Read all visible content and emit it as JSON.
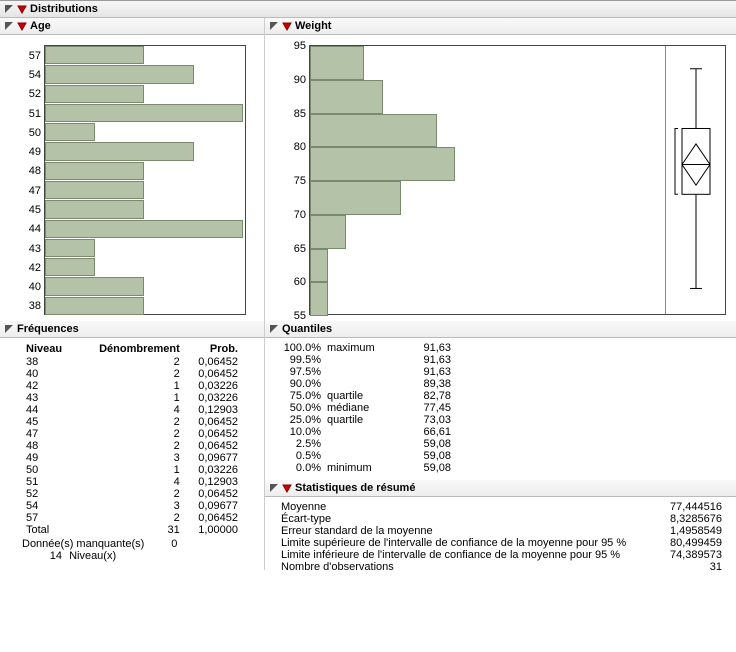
{
  "main": {
    "title": "Distributions"
  },
  "age": {
    "title": "Age",
    "freq_title": "Fréquences",
    "headers": {
      "level": "Niveau",
      "count": "Dénombrement",
      "prob": "Prob."
    },
    "rows": [
      {
        "level": "38",
        "count": 2,
        "prob": "0,06452"
      },
      {
        "level": "40",
        "count": 2,
        "prob": "0,06452"
      },
      {
        "level": "42",
        "count": 1,
        "prob": "0,03226"
      },
      {
        "level": "43",
        "count": 1,
        "prob": "0,03226"
      },
      {
        "level": "44",
        "count": 4,
        "prob": "0,12903"
      },
      {
        "level": "45",
        "count": 2,
        "prob": "0,06452"
      },
      {
        "level": "47",
        "count": 2,
        "prob": "0,06452"
      },
      {
        "level": "48",
        "count": 2,
        "prob": "0,06452"
      },
      {
        "level": "49",
        "count": 3,
        "prob": "0,09677"
      },
      {
        "level": "50",
        "count": 1,
        "prob": "0,03226"
      },
      {
        "level": "51",
        "count": 4,
        "prob": "0,12903"
      },
      {
        "level": "52",
        "count": 2,
        "prob": "0,06452"
      },
      {
        "level": "54",
        "count": 3,
        "prob": "0,09677"
      },
      {
        "level": "57",
        "count": 2,
        "prob": "0,06452"
      }
    ],
    "total_label": "Total",
    "total_count": 31,
    "total_prob": "1,00000",
    "missing_label": "Donnée(s) manquante(s)",
    "missing_val": 0,
    "nlevels_val": 14,
    "nlevels_label": "Niveau(x)"
  },
  "weight": {
    "title": "Weight",
    "quant_title": "Quantiles",
    "quantiles": [
      {
        "pct": "100.0%",
        "lab": "maximum",
        "val": "91,63"
      },
      {
        "pct": "99.5%",
        "lab": "",
        "val": "91,63"
      },
      {
        "pct": "97.5%",
        "lab": "",
        "val": "91,63"
      },
      {
        "pct": "90.0%",
        "lab": "",
        "val": "89,38"
      },
      {
        "pct": "75.0%",
        "lab": "quartile",
        "val": "82,78"
      },
      {
        "pct": "50.0%",
        "lab": "médiane",
        "val": "77,45"
      },
      {
        "pct": "25.0%",
        "lab": "quartile",
        "val": "73,03"
      },
      {
        "pct": "10.0%",
        "lab": "",
        "val": "66,61"
      },
      {
        "pct": "2.5%",
        "lab": "",
        "val": "59,08"
      },
      {
        "pct": "0.5%",
        "lab": "",
        "val": "59,08"
      },
      {
        "pct": "0.0%",
        "lab": "minimum",
        "val": "59,08"
      }
    ],
    "summ_title": "Statistiques de résumé",
    "summary": [
      {
        "lab": "Moyenne",
        "val": "77,444516"
      },
      {
        "lab": "Écart-type",
        "val": "8,3285676"
      },
      {
        "lab": "Erreur standard de la moyenne",
        "val": "1,4958549"
      },
      {
        "lab": "Limite supérieure de l'intervalle de confiance de la moyenne pour 95 %",
        "val": "80,499459"
      },
      {
        "lab": "Limite inférieure de l'intervalle de confiance de la moyenne pour 95 %",
        "val": "74,389573"
      },
      {
        "lab": "Nombre d'observations",
        "val": "31"
      }
    ]
  },
  "chart_data": [
    {
      "type": "bar",
      "orientation": "horizontal",
      "title": "Age",
      "categories": [
        "57",
        "54",
        "52",
        "51",
        "50",
        "49",
        "48",
        "47",
        "45",
        "44",
        "43",
        "42",
        "40",
        "38"
      ],
      "values": [
        2,
        3,
        2,
        4,
        1,
        3,
        2,
        2,
        2,
        4,
        1,
        1,
        2,
        2
      ],
      "xlim": [
        0,
        4
      ]
    },
    {
      "type": "bar",
      "orientation": "horizontal",
      "title": "Weight histogram",
      "bin_edges": [
        55,
        60,
        65,
        70,
        75,
        80,
        85,
        90,
        95
      ],
      "values": [
        1,
        1,
        2,
        5,
        8,
        7,
        4,
        3
      ],
      "ylim": [
        55,
        95
      ]
    },
    {
      "type": "boxplot",
      "title": "Weight box plot",
      "min": 59.08,
      "q1": 73.03,
      "median": 77.45,
      "mean": 77.44,
      "q3": 82.78,
      "max": 91.63,
      "ci_low": 74.39,
      "ci_high": 80.5,
      "ylim": [
        55,
        95
      ]
    }
  ]
}
